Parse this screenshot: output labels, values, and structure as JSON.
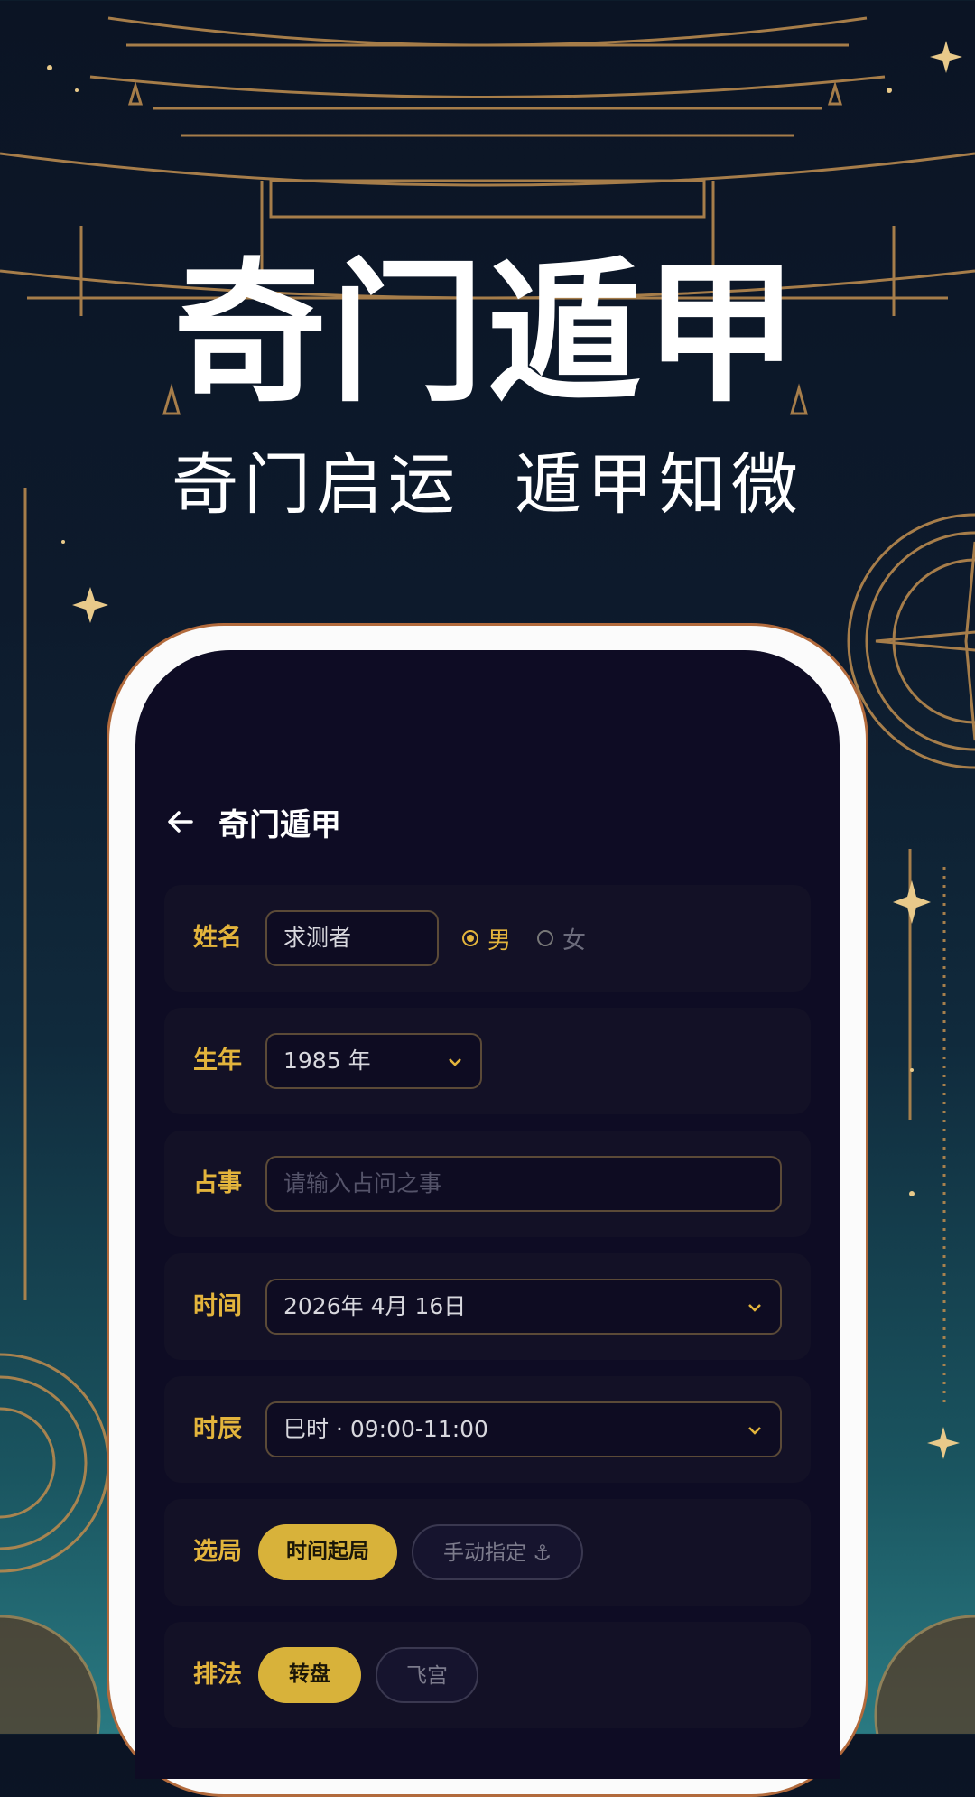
{
  "hero": {
    "title": "奇门遁甲",
    "subtitle_left": "奇门启运",
    "subtitle_right": "遁甲知微"
  },
  "app": {
    "back_icon": "arrow-left-icon",
    "title": "奇门遁甲"
  },
  "form": {
    "name": {
      "label": "姓名",
      "value": "求测者"
    },
    "gender": {
      "male": "男",
      "female": "女",
      "selected": "男"
    },
    "birth_year": {
      "label": "生年",
      "value": "1985 年"
    },
    "question": {
      "label": "占事",
      "placeholder": "请输入占问之事"
    },
    "time": {
      "label": "时间",
      "value": "2026年 4月 16日"
    },
    "hour": {
      "label": "时辰",
      "value": "巳时 · 09:00-11:00"
    },
    "mode": {
      "label": "选局",
      "options": [
        "时间起局",
        "手动指定 ⚓"
      ],
      "selected": "时间起局"
    },
    "method": {
      "label": "排法",
      "options": [
        "转盘",
        "飞宫"
      ],
      "selected": "转盘"
    }
  },
  "colors": {
    "accent": "#e3b43c",
    "screen_bg": "#0e0c24",
    "card_bg": "#131126"
  }
}
